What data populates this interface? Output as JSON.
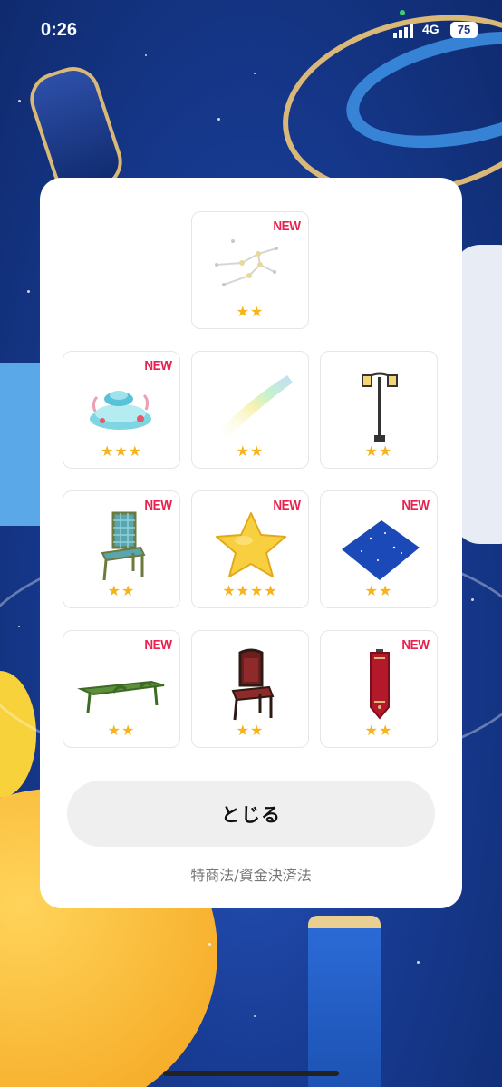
{
  "status_bar": {
    "time": "0:26",
    "network": "4G",
    "battery": "75"
  },
  "modal": {
    "items": [
      {
        "name": "constellation",
        "new": true,
        "stars": "★★"
      },
      {
        "name": "coral-fountain",
        "new": true,
        "stars": "★★★"
      },
      {
        "name": "rainbow-light",
        "new": false,
        "stars": "★★"
      },
      {
        "name": "street-lamp",
        "new": false,
        "stars": "★★"
      },
      {
        "name": "checkered-chair",
        "new": true,
        "stars": "★★"
      },
      {
        "name": "star-cushion",
        "new": true,
        "stars": "★★★★"
      },
      {
        "name": "starry-rug",
        "new": true,
        "stars": "★★"
      },
      {
        "name": "green-bench",
        "new": true,
        "stars": "★★"
      },
      {
        "name": "red-chair",
        "new": false,
        "stars": "★★"
      },
      {
        "name": "red-banner",
        "new": true,
        "stars": "★★"
      }
    ],
    "new_label": "NEW",
    "close_label": "とじる",
    "legal_link": "特商法/資金決済法"
  }
}
